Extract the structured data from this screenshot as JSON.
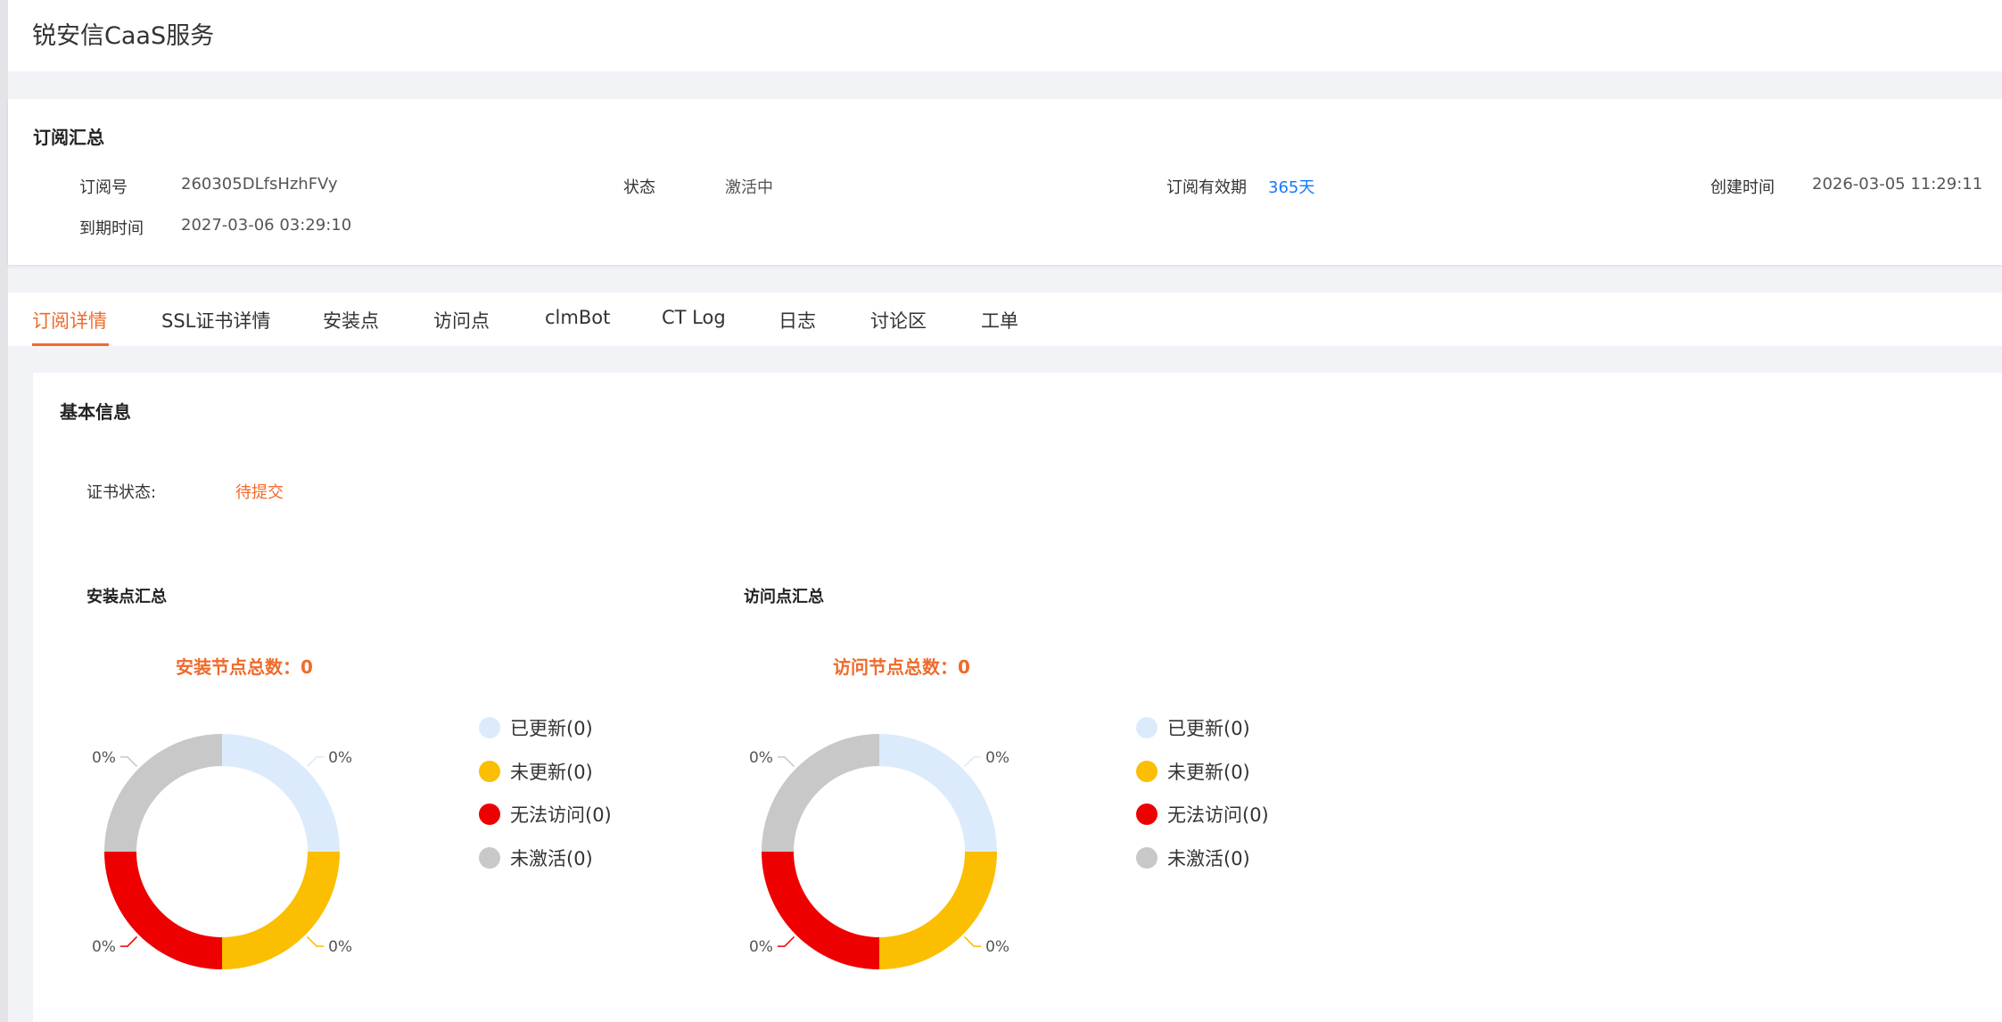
{
  "app": {
    "title": "锐安信CaaS服务"
  },
  "summary": {
    "title": "订阅汇总",
    "fields": {
      "order_no_label": "订阅号",
      "order_no": "260305DLfsHzhFVy",
      "status_label": "状态",
      "status": "激活中",
      "validity_label": "订阅有效期",
      "validity": "365天",
      "created_label": "创建时间",
      "created": "2026-03-05 11:29:11",
      "expiry_label": "到期时间",
      "expiry": "2027-03-06 03:29:10"
    }
  },
  "tabs": [
    {
      "label": "订阅详情",
      "active": true
    },
    {
      "label": "SSL证书详情"
    },
    {
      "label": "安装点"
    },
    {
      "label": "访问点"
    },
    {
      "label": "clmBot"
    },
    {
      "label": "CT Log"
    },
    {
      "label": "日志"
    },
    {
      "label": "讨论区"
    },
    {
      "label": "工单"
    }
  ],
  "basic_info": {
    "title": "基本信息",
    "cert_status_label": "证书状态:",
    "cert_status": "待提交"
  },
  "colors": {
    "accent": "#f06a2b",
    "link": "#1677ff",
    "updated": "#dcebfb",
    "not_updated": "#fbbe00",
    "unreachable": "#ee0000",
    "inactive": "#c8c8c8"
  },
  "chart_data": [
    {
      "type": "pie",
      "title": "安装点汇总",
      "subtitle": "安装节点总数：0",
      "categories": [
        "已更新(0)",
        "未更新(0)",
        "无法访问(0)",
        "未激活(0)"
      ],
      "values": [
        0,
        0,
        0,
        0
      ],
      "slice_labels": [
        "0%",
        "0%",
        "0%",
        "0%"
      ],
      "colors": [
        "#dcebfb",
        "#fbbe00",
        "#ee0000",
        "#c8c8c8"
      ],
      "legend_position": "right"
    },
    {
      "type": "pie",
      "title": "访问点汇总",
      "subtitle": "访问节点总数：0",
      "categories": [
        "已更新(0)",
        "未更新(0)",
        "无法访问(0)",
        "未激活(0)"
      ],
      "values": [
        0,
        0,
        0,
        0
      ],
      "slice_labels": [
        "0%",
        "0%",
        "0%",
        "0%"
      ],
      "colors": [
        "#dcebfb",
        "#fbbe00",
        "#ee0000",
        "#c8c8c8"
      ],
      "legend_position": "right"
    }
  ]
}
